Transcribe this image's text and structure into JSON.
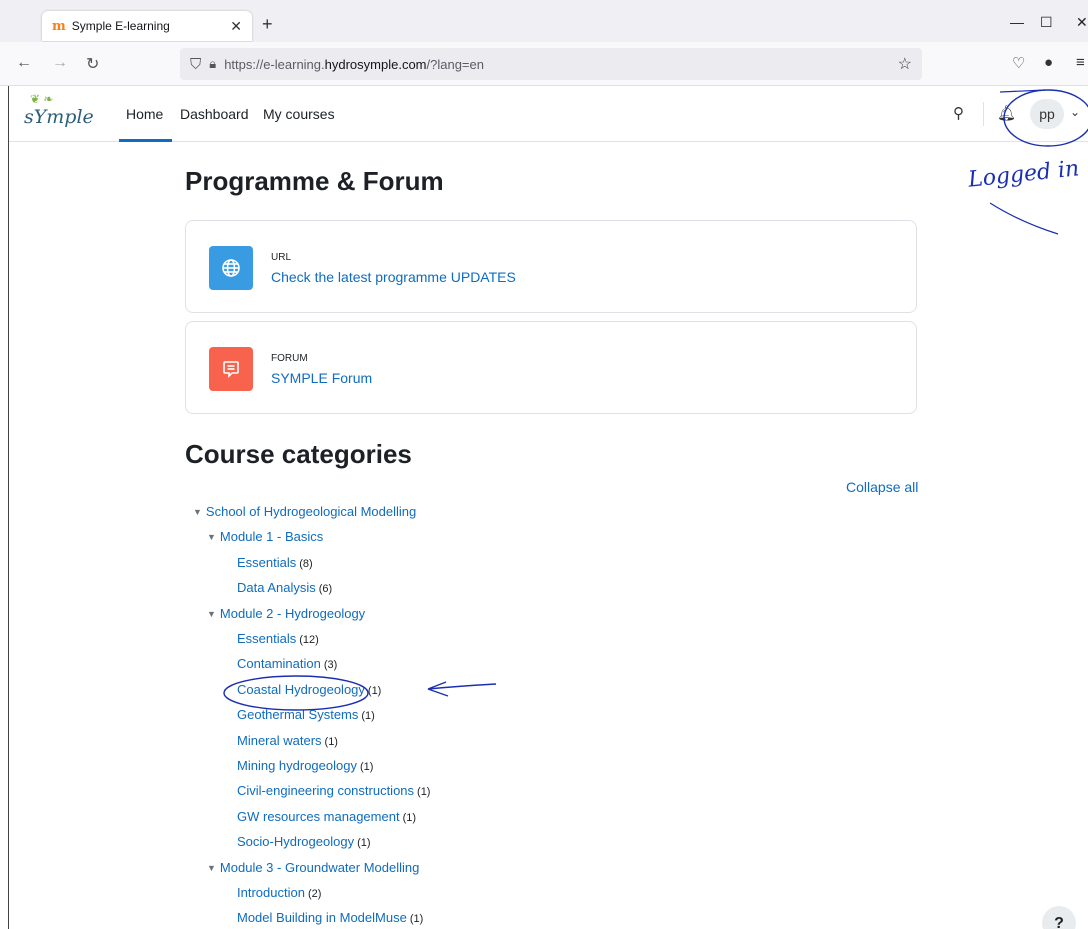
{
  "browser": {
    "tab_title": "Symple E-learning",
    "tab_favicon": "m",
    "url_prefix": "https://e-learning.",
    "url_host": "hydrosymple.com",
    "url_suffix": "/?lang=en"
  },
  "header": {
    "brand": "sYmple",
    "nav": [
      "Home",
      "Dashboard",
      "My courses"
    ],
    "avatar_initials": "pp"
  },
  "main": {
    "section1_title": "Programme & Forum",
    "activities": [
      {
        "type": "URL",
        "link": "Check the latest programme UPDATES",
        "icon": "globe-icon",
        "color": "#399be2"
      },
      {
        "type": "FORUM",
        "link": "SYMPLE Forum",
        "icon": "forum-icon",
        "color": "#f7634d"
      }
    ],
    "section2_title": "Course categories",
    "collapse_all": "Collapse all",
    "categories": [
      {
        "label": "School of Hydrogeological Modelling",
        "count": ""
      },
      {
        "label": "Module 1 - Basics",
        "count": ""
      },
      {
        "label": "Essentials",
        "count": "(8)"
      },
      {
        "label": "Data Analysis",
        "count": "(6)"
      },
      {
        "label": "Module 2 - Hydrogeology",
        "count": ""
      },
      {
        "label": "Essentials",
        "count": "(12)"
      },
      {
        "label": "Contamination",
        "count": "(3)"
      },
      {
        "label": "Coastal Hydrogeology",
        "count": "(1)"
      },
      {
        "label": "Geothermal Systems",
        "count": "(1)"
      },
      {
        "label": "Mineral waters",
        "count": "(1)"
      },
      {
        "label": "Mining hydrogeology",
        "count": "(1)"
      },
      {
        "label": "Civil-engineering constructions",
        "count": "(1)"
      },
      {
        "label": "GW resources management",
        "count": "(1)"
      },
      {
        "label": "Socio-Hydrogeology",
        "count": "(1)"
      },
      {
        "label": "Module 3 - Groundwater Modelling",
        "count": ""
      },
      {
        "label": "Introduction",
        "count": "(2)"
      },
      {
        "label": "Model Building in ModelMuse",
        "count": "(1)"
      }
    ],
    "help": "?"
  },
  "annotation": {
    "text": "Logged in",
    "color": "#1a2fb0"
  }
}
